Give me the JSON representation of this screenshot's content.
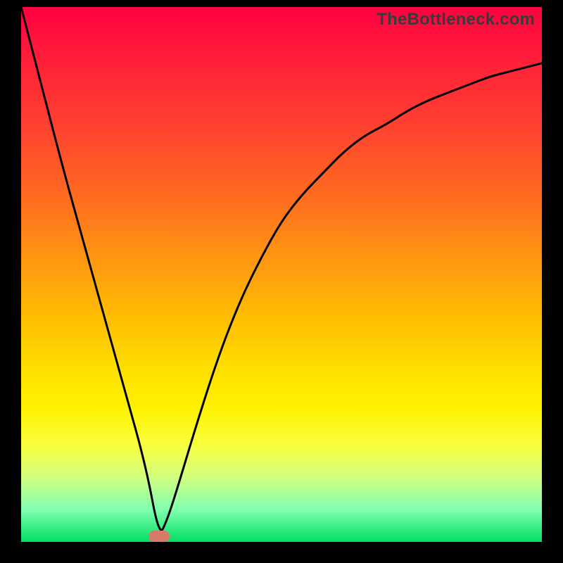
{
  "watermark": "TheBottleneck.com",
  "colors": {
    "background": "#000000",
    "curve": "#000000",
    "marker": "#d77a6a"
  },
  "chart_data": {
    "type": "line",
    "title": "",
    "xlabel": "",
    "ylabel": "",
    "xlim": [
      0,
      100
    ],
    "ylim": [
      0,
      100
    ],
    "grid": false,
    "series": [
      {
        "name": "bottleneck-curve",
        "x": [
          0,
          4,
          8,
          12,
          16,
          20,
          24,
          26.5,
          28,
          30,
          34,
          38,
          42,
          46,
          50,
          54,
          58,
          62,
          66,
          70,
          74,
          78,
          82,
          86,
          90,
          94,
          98,
          100
        ],
        "values": [
          100,
          85,
          70,
          56,
          42,
          28,
          14,
          1,
          4,
          10,
          23,
          35,
          45,
          53,
          60,
          65,
          69,
          73,
          76,
          78,
          80.5,
          82.5,
          84,
          85.5,
          87,
          88,
          89,
          89.5
        ]
      }
    ],
    "annotations": [
      {
        "name": "minimum-marker",
        "x": 26.5,
        "y": 1
      }
    ],
    "description": "V-shaped bottleneck curve over a vertical red-to-green gradient; minimum near x≈26.5. Values are visual estimates: x is horizontal position (0–100 left→right), values are height (0 at bottom, 100 at top)."
  }
}
